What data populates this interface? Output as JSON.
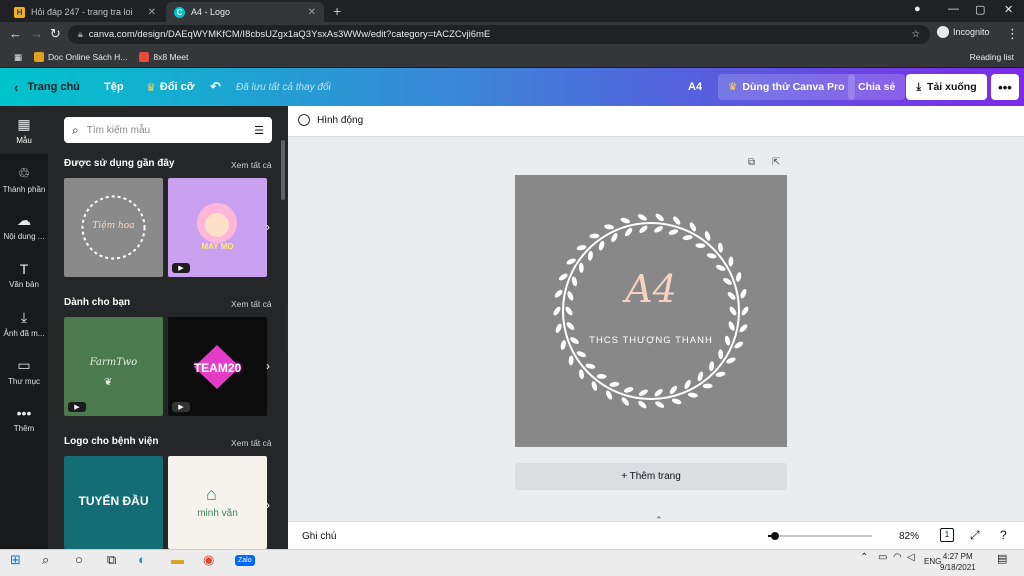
{
  "browser": {
    "tabs": [
      {
        "title": "Hỏi đáp 247 - trang tra loi",
        "active": false
      },
      {
        "title": "A4 - Logo",
        "active": true
      }
    ],
    "url": "canva.com/design/DAEqWYMKfCM/I8cbsUZgx1aQ3YsxAs3WWw/edit?category=tACZCvji6mE",
    "incognito_label": "Incognito",
    "bookmarks": [
      "Doc Online Sách H...",
      "8x8 Meet"
    ],
    "reading_list": "Reading list"
  },
  "header": {
    "back_label": "Trang chủ",
    "file_label": "Tệp",
    "resize_label": "Đổi cỡ",
    "saved_status": "Đã lưu tất cả thay đổi",
    "size_label": "A4",
    "pro_label": "Dùng thử Canva Pro",
    "share_label": "Chia sẻ",
    "download_label": "Tải xuống",
    "more_label": "•••"
  },
  "rail": [
    {
      "label": "Mẫu",
      "icon": "template-icon",
      "glyph": "▦"
    },
    {
      "label": "Thành phần",
      "icon": "elements-icon",
      "glyph": "♲"
    },
    {
      "label": "Nội dung ...",
      "icon": "upload-icon",
      "glyph": "☁"
    },
    {
      "label": "Văn bản",
      "icon": "text-icon",
      "glyph": "T"
    },
    {
      "label": "Ảnh đã m...",
      "icon": "download-icon",
      "glyph": "⤓"
    },
    {
      "label": "Thư mục",
      "icon": "folder-icon",
      "glyph": "▭"
    },
    {
      "label": "Thêm",
      "icon": "more-icon",
      "glyph": "•••"
    }
  ],
  "panel": {
    "search_placeholder": "Tìm kiếm mẫu",
    "see_all": "Xem tất cả",
    "sections": [
      {
        "title": "Được sử dụng gần đây",
        "thumbs": [
          {
            "text": "Tiệm hoa",
            "bg": "#8a8a8a",
            "fg": "#f3d9c8",
            "video": false
          },
          {
            "text": "MAY MO",
            "bg": "#c9a1f0",
            "fg": "#ffe86b",
            "video": true
          }
        ]
      },
      {
        "title": "Dành cho bạn",
        "thumbs": [
          {
            "text": "FarmTwo",
            "bg": "#4a7a4e",
            "fg": "#e8efe3",
            "video": true
          },
          {
            "text": "TEAM20",
            "bg": "#0c0c0c",
            "fg": "#ff4fd8",
            "video": true
          }
        ]
      },
      {
        "title": "Logo cho bệnh viện",
        "thumbs": [
          {
            "text": "TUYẾN ĐẦU",
            "bg": "#146c74",
            "fg": "#ffffff",
            "video": false
          },
          {
            "text": "minh văn",
            "bg": "#f5f3ec",
            "fg": "#3e8a5a",
            "video": false
          }
        ]
      }
    ]
  },
  "editor": {
    "animate_label": "Hình động",
    "page_bg": "#888889",
    "logo_title": "A4",
    "logo_subtitle": "THCS THƯỢNG THANH",
    "add_page_label": "+ Thêm trang"
  },
  "footer": {
    "notes_label": "Ghi chú",
    "zoom_label": "82%",
    "page_count": "1"
  },
  "taskbar": {
    "lang": "ENG",
    "time": "4:27 PM",
    "date": "9/18/2021"
  }
}
